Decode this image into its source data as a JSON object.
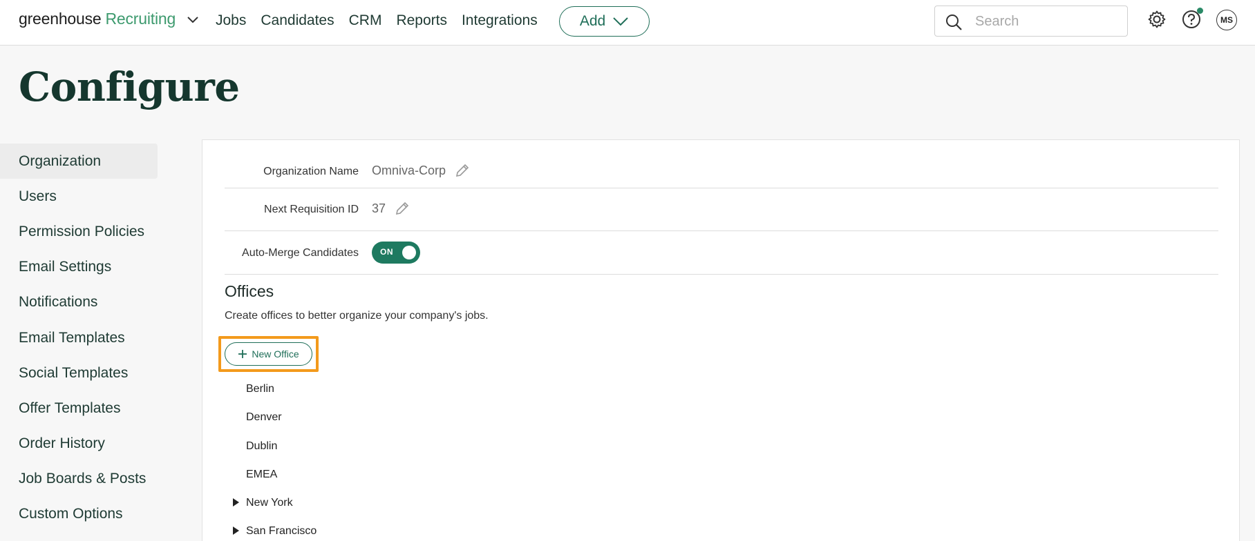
{
  "nav": {
    "brand_primary": "greenhouse",
    "brand_secondary": "Recruiting",
    "brand_color": "#3d9a6e",
    "links": [
      "Jobs",
      "Candidates",
      "CRM",
      "Reports",
      "Integrations"
    ],
    "add_label": "Add",
    "search_placeholder": "Search",
    "avatar_initials": "MS",
    "accent_color": "#1f6e58"
  },
  "page": {
    "title": "Configure"
  },
  "sidebar": {
    "items": [
      {
        "label": "Organization",
        "active": true
      },
      {
        "label": "Users"
      },
      {
        "label": "Permission Policies"
      },
      {
        "label": "Email Settings"
      },
      {
        "label": "Notifications"
      },
      {
        "label": "Email Templates"
      },
      {
        "label": "Social Templates"
      },
      {
        "label": "Offer Templates"
      },
      {
        "label": "Order History"
      },
      {
        "label": "Job Boards & Posts"
      },
      {
        "label": "Custom Options"
      }
    ]
  },
  "organization": {
    "name_label": "Organization Name",
    "name_value": "Omniva-Corp",
    "req_label": "Next Requisition ID",
    "req_value": "37",
    "automerge_label": "Auto-Merge Candidates",
    "automerge_state": "ON"
  },
  "offices": {
    "heading": "Offices",
    "description": "Create offices to better organize your company's jobs.",
    "new_button": "New Office",
    "highlight_color": "#f39a1c",
    "items": [
      {
        "label": "Berlin",
        "expandable": false
      },
      {
        "label": "Denver",
        "expandable": false
      },
      {
        "label": "Dublin",
        "expandable": false
      },
      {
        "label": "EMEA",
        "expandable": false
      },
      {
        "label": "New York",
        "expandable": true
      },
      {
        "label": "San Francisco",
        "expandable": true
      }
    ]
  }
}
